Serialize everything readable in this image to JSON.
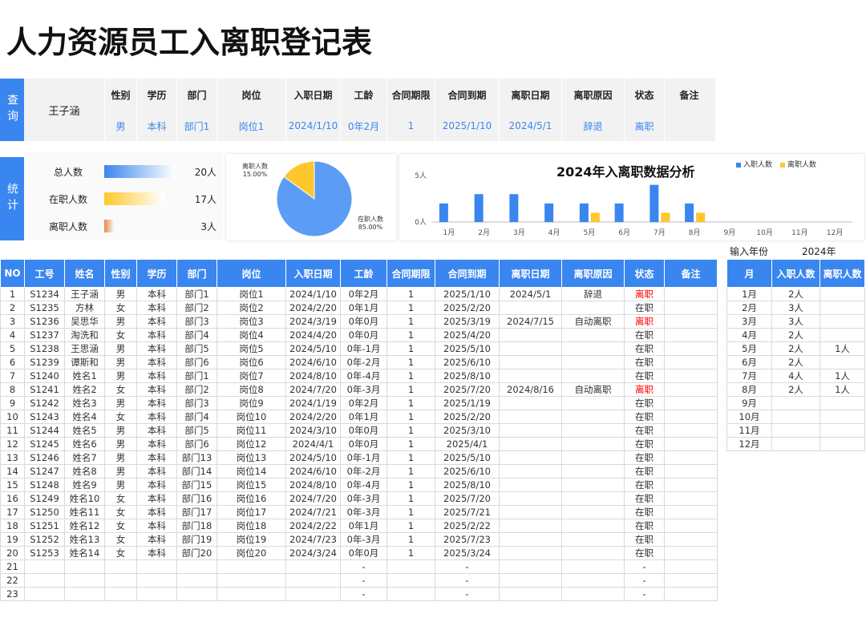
{
  "title": "人力资源员工入离职登记表",
  "query": {
    "side_label": "查询",
    "name": "王子涵",
    "headers": [
      "性别",
      "学历",
      "部门",
      "岗位",
      "入职日期",
      "工龄",
      "合同期限",
      "合同到期",
      "离职日期",
      "离职原因",
      "状态",
      "备注"
    ],
    "values": [
      "男",
      "本科",
      "部门1",
      "岗位1",
      "2024/1/10",
      "0年2月",
      "1",
      "2025/1/10",
      "2024/5/1",
      "辞退",
      "离职",
      ""
    ]
  },
  "stats": {
    "side_label": "统计",
    "rows": [
      {
        "label": "总人数",
        "value": "20人",
        "count": 20,
        "color": "#3a86f0"
      },
      {
        "label": "在职人数",
        "value": "17人",
        "count": 17,
        "color": "#ffc72c"
      },
      {
        "label": "离职人数",
        "value": "3人",
        "count": 3,
        "color": "#e8864a"
      }
    ]
  },
  "pie_chart": {
    "type": "pie",
    "slices": [
      {
        "name": "离职人数",
        "value": 15.0,
        "label": "15.00%",
        "color": "#ffc72c"
      },
      {
        "name": "在职人数",
        "value": 85.0,
        "label": "85.00%",
        "color": "#5b9cf5"
      }
    ]
  },
  "chart_data": {
    "type": "bar",
    "title": "2024年入离职数据分析",
    "categories": [
      "1月",
      "2月",
      "3月",
      "4月",
      "5月",
      "6月",
      "7月",
      "8月",
      "9月",
      "10月",
      "11月",
      "12月"
    ],
    "series": [
      {
        "name": "入职人数",
        "color": "#3a86f0",
        "values": [
          2,
          3,
          3,
          2,
          2,
          2,
          4,
          2,
          0,
          0,
          0,
          0
        ]
      },
      {
        "name": "离职人数",
        "color": "#ffc72c",
        "values": [
          0,
          0,
          0,
          0,
          1,
          0,
          1,
          1,
          0,
          0,
          0,
          0
        ]
      }
    ],
    "y_ticks": [
      "0人",
      "5人"
    ],
    "ylim": [
      0,
      5
    ]
  },
  "year_input": {
    "label": "输入年份",
    "value": "2024年"
  },
  "table": {
    "headers": [
      "NO",
      "工号",
      "姓名",
      "性别",
      "学历",
      "部门",
      "岗位",
      "入职日期",
      "工龄",
      "合同期限",
      "合同到期",
      "离职日期",
      "离职原因",
      "状态",
      "备注"
    ],
    "rows": [
      [
        "1",
        "S1234",
        "王子涵",
        "男",
        "本科",
        "部门1",
        "岗位1",
        "2024/1/10",
        "0年2月",
        "1",
        "2025/1/10",
        "2024/5/1",
        "辞退",
        "离职",
        ""
      ],
      [
        "2",
        "S1235",
        "方林",
        "女",
        "本科",
        "部门2",
        "岗位2",
        "2024/2/20",
        "0年1月",
        "1",
        "2025/2/20",
        "",
        "",
        "在职",
        ""
      ],
      [
        "3",
        "S1236",
        "吴思华",
        "男",
        "本科",
        "部门3",
        "岗位3",
        "2024/3/19",
        "0年0月",
        "1",
        "2025/3/19",
        "2024/7/15",
        "自动离职",
        "离职",
        ""
      ],
      [
        "4",
        "S1237",
        "淘洗和",
        "女",
        "本科",
        "部门4",
        "岗位4",
        "2024/4/20",
        "0年0月",
        "1",
        "2025/4/20",
        "",
        "",
        "在职",
        ""
      ],
      [
        "5",
        "S1238",
        "王思涵",
        "男",
        "本科",
        "部门5",
        "岗位5",
        "2024/5/10",
        "0年-1月",
        "1",
        "2025/5/10",
        "",
        "",
        "在职",
        ""
      ],
      [
        "6",
        "S1239",
        "谭斯和",
        "男",
        "本科",
        "部门6",
        "岗位6",
        "2024/6/10",
        "0年-2月",
        "1",
        "2025/6/10",
        "",
        "",
        "在职",
        ""
      ],
      [
        "7",
        "S1240",
        "姓名1",
        "男",
        "本科",
        "部门1",
        "岗位7",
        "2024/8/10",
        "0年-4月",
        "1",
        "2025/8/10",
        "",
        "",
        "在职",
        ""
      ],
      [
        "8",
        "S1241",
        "姓名2",
        "女",
        "本科",
        "部门2",
        "岗位8",
        "2024/7/20",
        "0年-3月",
        "1",
        "2025/7/20",
        "2024/8/16",
        "自动离职",
        "离职",
        ""
      ],
      [
        "9",
        "S1242",
        "姓名3",
        "男",
        "本科",
        "部门3",
        "岗位9",
        "2024/1/19",
        "0年2月",
        "1",
        "2025/1/19",
        "",
        "",
        "在职",
        ""
      ],
      [
        "10",
        "S1243",
        "姓名4",
        "女",
        "本科",
        "部门4",
        "岗位10",
        "2024/2/20",
        "0年1月",
        "1",
        "2025/2/20",
        "",
        "",
        "在职",
        ""
      ],
      [
        "11",
        "S1244",
        "姓名5",
        "男",
        "本科",
        "部门5",
        "岗位11",
        "2024/3/10",
        "0年0月",
        "1",
        "2025/3/10",
        "",
        "",
        "在职",
        ""
      ],
      [
        "12",
        "S1245",
        "姓名6",
        "男",
        "本科",
        "部门6",
        "岗位12",
        "2024/4/1",
        "0年0月",
        "1",
        "2025/4/1",
        "",
        "",
        "在职",
        ""
      ],
      [
        "13",
        "S1246",
        "姓名7",
        "男",
        "本科",
        "部门13",
        "岗位13",
        "2024/5/10",
        "0年-1月",
        "1",
        "2025/5/10",
        "",
        "",
        "在职",
        ""
      ],
      [
        "14",
        "S1247",
        "姓名8",
        "男",
        "本科",
        "部门14",
        "岗位14",
        "2024/6/10",
        "0年-2月",
        "1",
        "2025/6/10",
        "",
        "",
        "在职",
        ""
      ],
      [
        "15",
        "S1248",
        "姓名9",
        "男",
        "本科",
        "部门15",
        "岗位15",
        "2024/8/10",
        "0年-4月",
        "1",
        "2025/8/10",
        "",
        "",
        "在职",
        ""
      ],
      [
        "16",
        "S1249",
        "姓名10",
        "女",
        "本科",
        "部门16",
        "岗位16",
        "2024/7/20",
        "0年-3月",
        "1",
        "2025/7/20",
        "",
        "",
        "在职",
        ""
      ],
      [
        "17",
        "S1250",
        "姓名11",
        "女",
        "本科",
        "部门17",
        "岗位17",
        "2024/7/21",
        "0年-3月",
        "1",
        "2025/7/21",
        "",
        "",
        "在职",
        ""
      ],
      [
        "18",
        "S1251",
        "姓名12",
        "女",
        "本科",
        "部门18",
        "岗位18",
        "2024/2/22",
        "0年1月",
        "1",
        "2025/2/22",
        "",
        "",
        "在职",
        ""
      ],
      [
        "19",
        "S1252",
        "姓名13",
        "女",
        "本科",
        "部门19",
        "岗位19",
        "2024/7/23",
        "0年-3月",
        "1",
        "2025/7/23",
        "",
        "",
        "在职",
        ""
      ],
      [
        "20",
        "S1253",
        "姓名14",
        "女",
        "本科",
        "部门20",
        "岗位20",
        "2024/3/24",
        "0年0月",
        "1",
        "2025/3/24",
        "",
        "",
        "在职",
        ""
      ],
      [
        "21",
        "",
        "",
        "",
        "",
        "",
        "",
        "",
        "-",
        "",
        "-",
        "",
        "",
        "-",
        ""
      ],
      [
        "22",
        "",
        "",
        "",
        "",
        "",
        "",
        "",
        "-",
        "",
        "-",
        "",
        "",
        "-",
        ""
      ],
      [
        "23",
        "",
        "",
        "",
        "",
        "",
        "",
        "",
        "-",
        "",
        "-",
        "",
        "",
        "-",
        ""
      ]
    ]
  },
  "month_table": {
    "headers": [
      "月",
      "入职人数",
      "离职人数"
    ],
    "rows": [
      [
        "1月",
        "2人",
        ""
      ],
      [
        "2月",
        "3人",
        ""
      ],
      [
        "3月",
        "3人",
        ""
      ],
      [
        "4月",
        "2人",
        ""
      ],
      [
        "5月",
        "2人",
        "1人"
      ],
      [
        "6月",
        "2人",
        ""
      ],
      [
        "7月",
        "4人",
        "1人"
      ],
      [
        "8月",
        "2人",
        "1人"
      ],
      [
        "9月",
        "",
        ""
      ],
      [
        "10月",
        "",
        ""
      ],
      [
        "11月",
        "",
        ""
      ],
      [
        "12月",
        "",
        ""
      ]
    ]
  }
}
